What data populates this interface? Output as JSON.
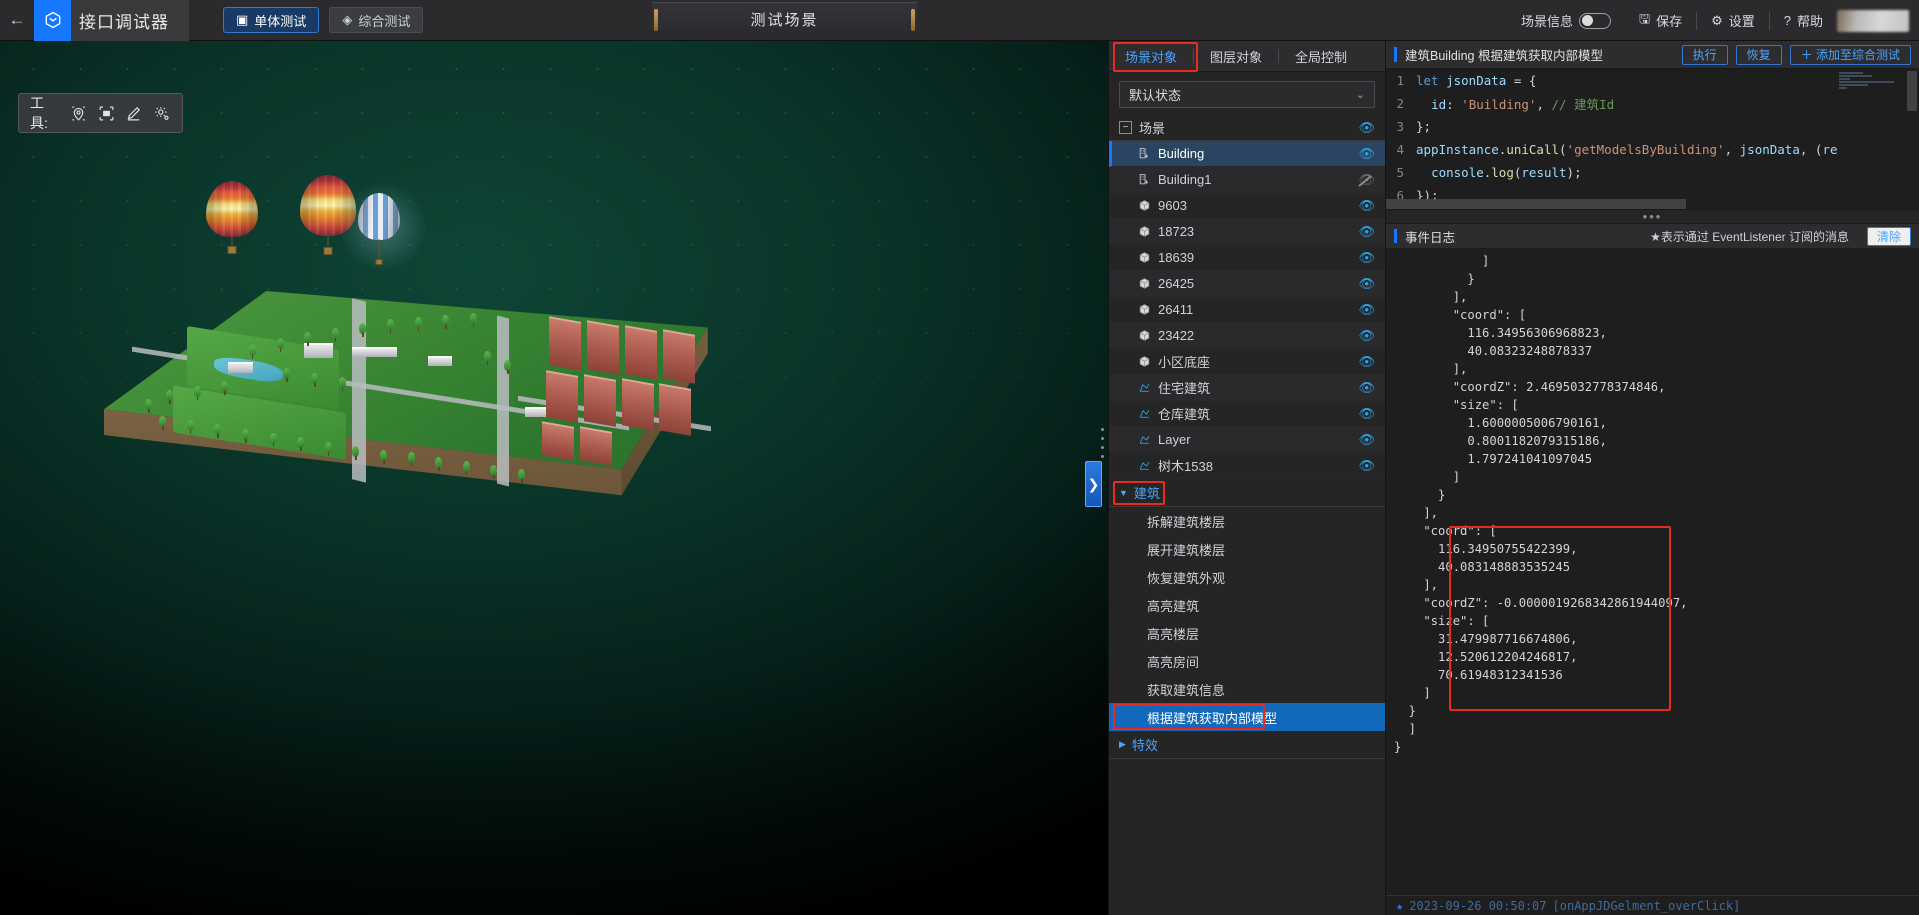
{
  "topbar": {
    "back_icon": "arrow-left-icon",
    "logo_icon": "cube-logo-icon",
    "app_title": "接口调试器",
    "tabs": [
      {
        "label": "单体测试",
        "icon": "cube-icon",
        "active": true
      },
      {
        "label": "综合测试",
        "icon": "layers-icon",
        "active": false
      }
    ],
    "scene_name": "测试场景",
    "scene_info_label": "场景信息",
    "scene_info_on": false,
    "save_label": "保存",
    "save_icon": "save-icon",
    "settings_label": "设置",
    "settings_icon": "gear-icon",
    "help_label": "帮助",
    "help_icon": "question-icon"
  },
  "viewport": {
    "tool_label": "工具:",
    "tools": [
      {
        "name": "pin-marker-icon"
      },
      {
        "name": "box-select-icon"
      },
      {
        "name": "pencil-draw-icon"
      },
      {
        "name": "settings-gear-icon"
      }
    ],
    "collapse_icon": "chevron-right-icon"
  },
  "scene_panel": {
    "tabs": [
      {
        "label": "场景对象",
        "active": true
      },
      {
        "label": "图层对象",
        "active": false
      },
      {
        "label": "全局控制",
        "active": false
      }
    ],
    "state_select": {
      "value": "默认状态",
      "chevron": "chevron-down-icon"
    },
    "root": {
      "label": "场景",
      "expander": "−",
      "eye": "eye-icon",
      "visible": true
    },
    "items": [
      {
        "label": "Building",
        "icon": "building-icon",
        "visible": true,
        "selected": true
      },
      {
        "label": "Building1",
        "icon": "building-icon",
        "visible": false,
        "selected": false
      },
      {
        "label": "9603",
        "icon": "cube-icon",
        "visible": true,
        "selected": false
      },
      {
        "label": "18723",
        "icon": "cube-icon",
        "visible": true,
        "selected": false
      },
      {
        "label": "18639",
        "icon": "cube-icon",
        "visible": true,
        "selected": false
      },
      {
        "label": "26425",
        "icon": "cube-icon",
        "visible": true,
        "selected": false
      },
      {
        "label": "26411",
        "icon": "cube-icon",
        "visible": true,
        "selected": false
      },
      {
        "label": "23422",
        "icon": "cube-icon",
        "visible": true,
        "selected": false
      },
      {
        "label": "小区底座",
        "icon": "cube-icon",
        "visible": true,
        "selected": false
      },
      {
        "label": "住宅建筑",
        "icon": "polygon-icon",
        "visible": true,
        "selected": false
      },
      {
        "label": "仓库建筑",
        "icon": "polygon-icon",
        "visible": true,
        "selected": false
      },
      {
        "label": "Layer",
        "icon": "polygon-icon",
        "visible": true,
        "selected": false
      },
      {
        "label": "树木1538",
        "icon": "polygon-icon",
        "visible": true,
        "selected": false
      }
    ],
    "groups": [
      {
        "label": "建筑",
        "caret": "caret-down-icon",
        "expanded": true,
        "highlighted": true,
        "methods": [
          {
            "label": "拆解建筑楼层",
            "active": false
          },
          {
            "label": "展开建筑楼层",
            "active": false
          },
          {
            "label": "恢复建筑外观",
            "active": false
          },
          {
            "label": "高亮建筑",
            "active": false
          },
          {
            "label": "高亮楼层",
            "active": false
          },
          {
            "label": "高亮房间",
            "active": false
          },
          {
            "label": "获取建筑信息",
            "active": false
          },
          {
            "label": "根据建筑获取内部模型",
            "active": true
          }
        ]
      },
      {
        "label": "特效",
        "caret": "caret-right-icon",
        "expanded": false,
        "highlighted": false,
        "methods": []
      }
    ]
  },
  "code_panel": {
    "title": "建筑Building 根据建筑获取内部模型",
    "buttons": [
      {
        "label": "执行"
      },
      {
        "label": "恢复"
      },
      {
        "label": "＋ 添加至综合测试"
      }
    ],
    "lines": [
      {
        "n": "1",
        "text": "let jsonData = {"
      },
      {
        "n": "2",
        "text": "  id: 'Building', // 建筑Id"
      },
      {
        "n": "3",
        "text": "};"
      },
      {
        "n": "4",
        "text": "appInstance.uniCall('getModelsByBuilding', jsonData, (re"
      },
      {
        "n": "5",
        "text": "  console.log(result);"
      },
      {
        "n": "6",
        "text": "});"
      }
    ]
  },
  "log_panel": {
    "title": "事件日志",
    "note": "★表示通过 EventListener 订阅的消息",
    "clear_label": "清除",
    "lines": [
      "            ]",
      "          }",
      "        ],",
      "        \"coord\": [",
      "          116.34956306968823,",
      "          40.08323248878337",
      "        ],",
      "        \"coordZ\": 2.4695032778374846,",
      "        \"size\": [",
      "          1.6000005006790161,",
      "          0.8001182079315186,",
      "          1.797241041097045",
      "        ]",
      "      }",
      "    ],",
      "    \"coord\": [",
      "      116.34950755422399,",
      "      40.083148883535245",
      "    ],",
      "    \"coordZ\": -0.0000019268342861944097,",
      "    \"size\": [",
      "      31.479987716674806,",
      "      12.520612204246817,",
      "      70.61948312341536",
      "    ]",
      "  }",
      "  ]",
      "}"
    ],
    "footer": {
      "star": "★",
      "timestamp": "2023-09-26 00:50:07",
      "message": "[onAppJDGelment_overClick]"
    }
  },
  "colors": {
    "accent": "#1677ff",
    "highlight_red": "#ea2a21",
    "link_blue": "#4aa3ff",
    "panel_bg": "#252526",
    "editor_bg": "#1e1e1e"
  }
}
